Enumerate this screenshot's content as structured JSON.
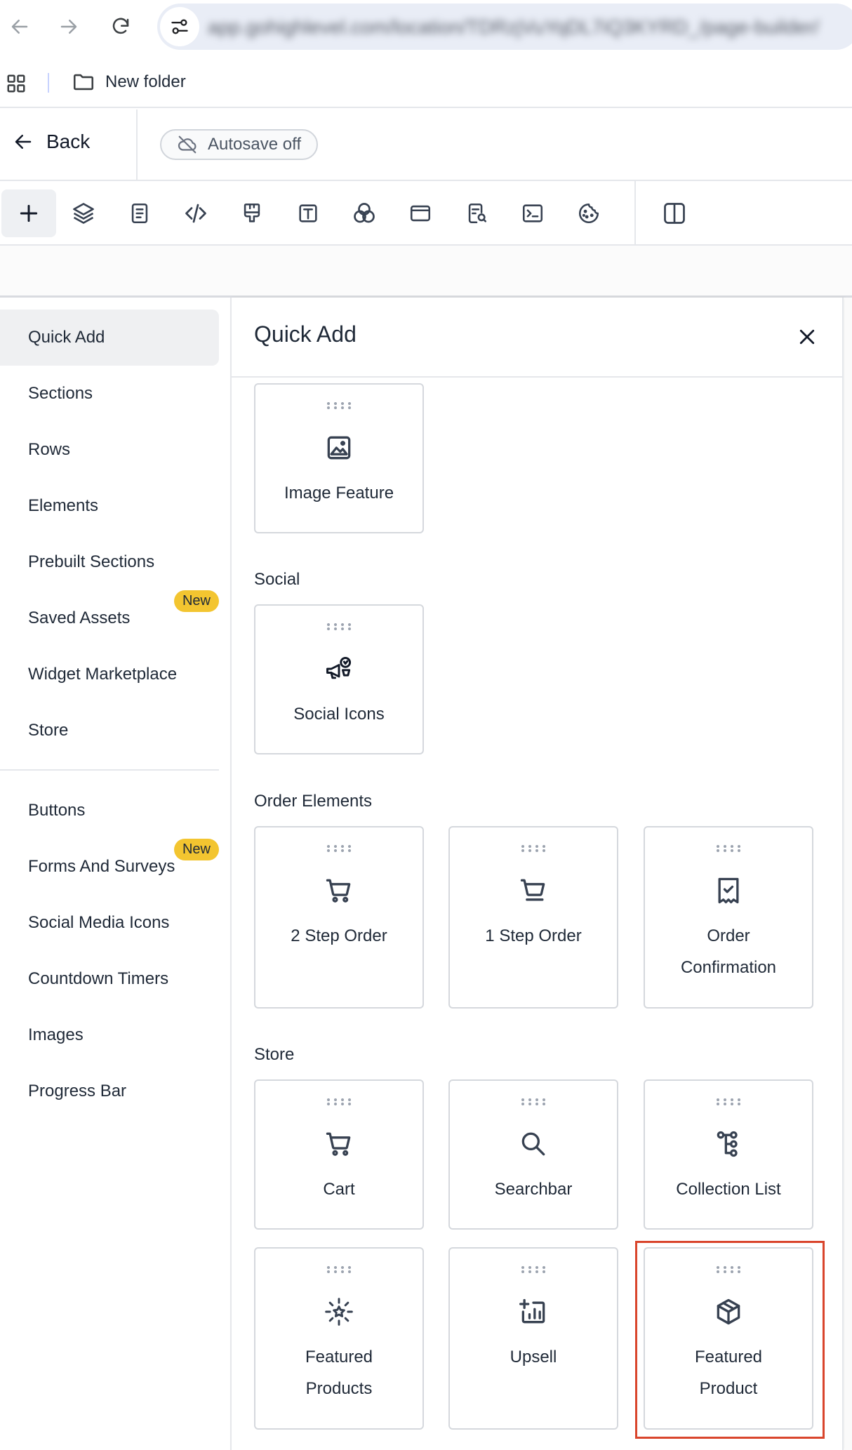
{
  "browser": {
    "url": "app.gohighlevel.com/location/TDRzjVuYqDL7iQ3KYRD_/page-builder/",
    "bookmark_folder": "New folder"
  },
  "header": {
    "back_label": "Back",
    "autosave_label": "Autosave off"
  },
  "toolbar": {
    "tools": [
      "add",
      "layers",
      "page-settings",
      "custom-code",
      "styles",
      "typography",
      "colors",
      "popup",
      "seo-tracking",
      "custom-js",
      "cookie-consent",
      "split-view"
    ]
  },
  "nav": {
    "primary": [
      {
        "label": "Quick Add",
        "active": true
      },
      {
        "label": "Sections"
      },
      {
        "label": "Rows"
      },
      {
        "label": "Elements"
      },
      {
        "label": "Prebuilt Sections"
      },
      {
        "label": "Saved Assets",
        "badge": "New"
      },
      {
        "label": "Widget Marketplace"
      },
      {
        "label": "Store"
      }
    ],
    "secondary": [
      {
        "label": "Buttons"
      },
      {
        "label": "Forms And Surveys",
        "badge": "New"
      },
      {
        "label": "Social Media Icons"
      },
      {
        "label": "Countdown Timers"
      },
      {
        "label": "Images"
      },
      {
        "label": "Progress Bar"
      }
    ]
  },
  "panel": {
    "title": "Quick Add",
    "sections": {
      "social": "Social",
      "order": "Order Elements",
      "store": "Store"
    },
    "cards": {
      "image_feature": "Image Feature",
      "social_icons": "Social Icons",
      "two_step": "2 Step Order",
      "one_step": "1 Step Order",
      "order_conf_1": "Order",
      "order_conf_2": "Confirmation",
      "cart": "Cart",
      "searchbar": "Searchbar",
      "collection_list": "Collection List",
      "featured_products_1": "Featured",
      "featured_products_2": "Products",
      "upsell": "Upsell",
      "featured_product_1": "Featured",
      "featured_product_2": "Product"
    }
  },
  "colors": {
    "badge": "#f3c530",
    "highlight": "#d9452c",
    "active_nav": "#eff0f2"
  }
}
